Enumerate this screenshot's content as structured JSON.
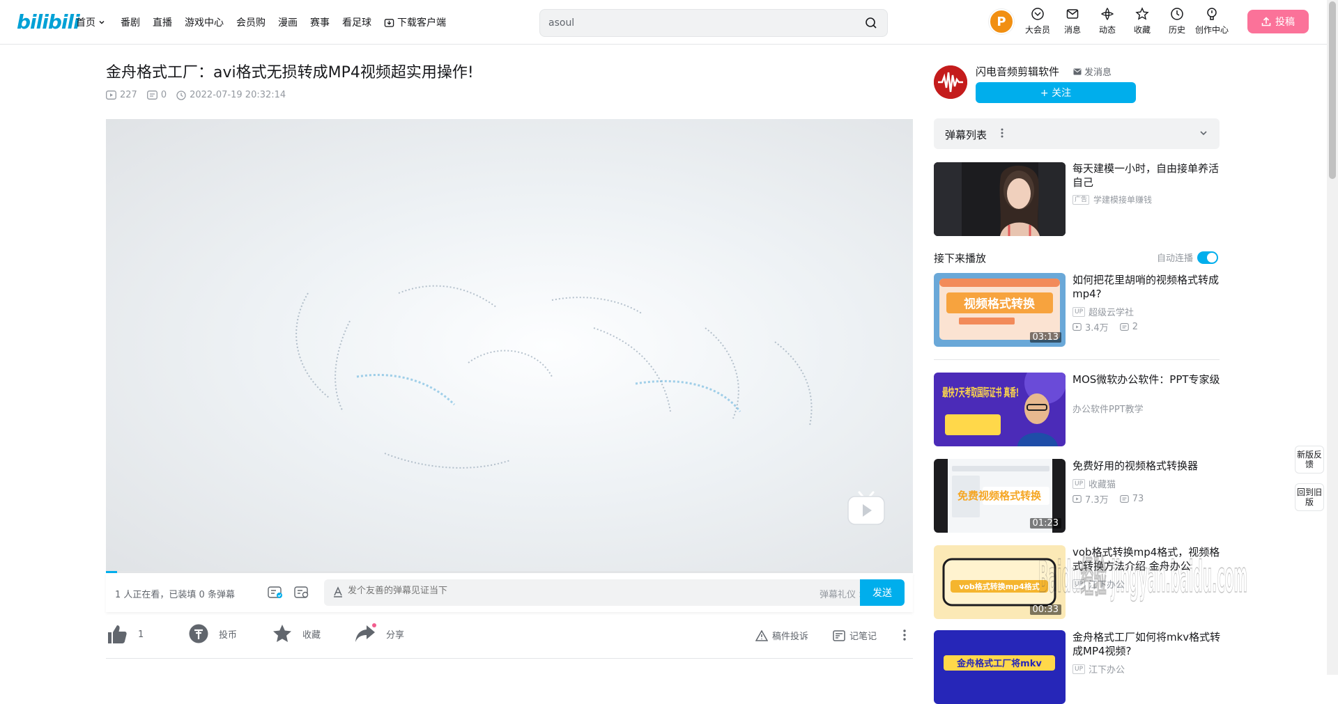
{
  "header": {
    "logo": "bilibili",
    "nav": [
      "首页",
      "番剧",
      "直播",
      "游戏中心",
      "会员购",
      "漫画",
      "赛事",
      "看足球",
      "下载客户端"
    ],
    "search": {
      "value": "asoul"
    },
    "icons": [
      {
        "label": "大会员",
        "icon": "vip-icon"
      },
      {
        "label": "消息",
        "icon": "message-icon"
      },
      {
        "label": "动态",
        "icon": "dynamic-icon"
      },
      {
        "label": "收藏",
        "icon": "favorite-icon"
      },
      {
        "label": "历史",
        "icon": "history-icon"
      },
      {
        "label": "创作中心",
        "icon": "creator-icon"
      }
    ],
    "upload": "投稿"
  },
  "video": {
    "title": "金舟格式工厂：avi格式无损转成MP4视频超实用操作!",
    "views": "227",
    "danmaku": "0",
    "date": "2022-07-19 20:32:14",
    "progress_fraction": 0.014
  },
  "danmaku_bar": {
    "viewers": "1 人正在看，已装填 0 条弹幕",
    "placeholder": "发个友善的弹幕见证当下",
    "etiquette": "弹幕礼仪 >",
    "send": "发送"
  },
  "actions": {
    "like_count": "1",
    "coin": "投币",
    "favorite": "收藏",
    "share": "分享",
    "report": "稿件投诉",
    "note": "记笔记"
  },
  "uploader": {
    "name": "闪电音频剪辑软件",
    "message": "发消息",
    "follow": "+ 关注"
  },
  "danmaku_list": {
    "title": "弹幕列表"
  },
  "ad": {
    "title": "每天建模一小时，自由接单养活自己",
    "badge": "广告",
    "source": "学建模接单赚钱"
  },
  "next": {
    "title": "接下来播放",
    "autoplay": "自动连播"
  },
  "recommendations": [
    {
      "title": "如何把花里胡哨的视频格式转成mp4?",
      "author": "超级云学社",
      "views": "3.4万",
      "danmaku": "2",
      "duration": "03:13",
      "thumb_text": "视频格式转换"
    },
    {
      "title": "MOS微软办公软件：PPT专家级",
      "author": "办公软件PPT教学",
      "views": "",
      "danmaku": "",
      "duration": "",
      "thumb_text": "最快7天考取国际证书 真香!"
    },
    {
      "title": "免费好用的视频格式转换器",
      "author": "收藏猫",
      "views": "7.3万",
      "danmaku": "73",
      "duration": "01:23",
      "thumb_text": "免费视频格式转换"
    },
    {
      "title": "vob格式转换mp4格式，视频格式转换方法介绍 金舟办公",
      "author": "江下办公",
      "views": "",
      "danmaku": "",
      "duration": "00:33",
      "thumb_text": "vob格式转换mp4格式"
    },
    {
      "title": "金舟格式工厂如何将mkv格式转成MP4视频?",
      "author": "江下办公",
      "views": "",
      "danmaku": "",
      "duration": "",
      "thumb_text": "金舟格式工厂将mkv"
    }
  ],
  "side_float": [
    "新版反馈",
    "回到旧版"
  ],
  "watermark": "Baidu经验 jingyan.baidu.com"
}
